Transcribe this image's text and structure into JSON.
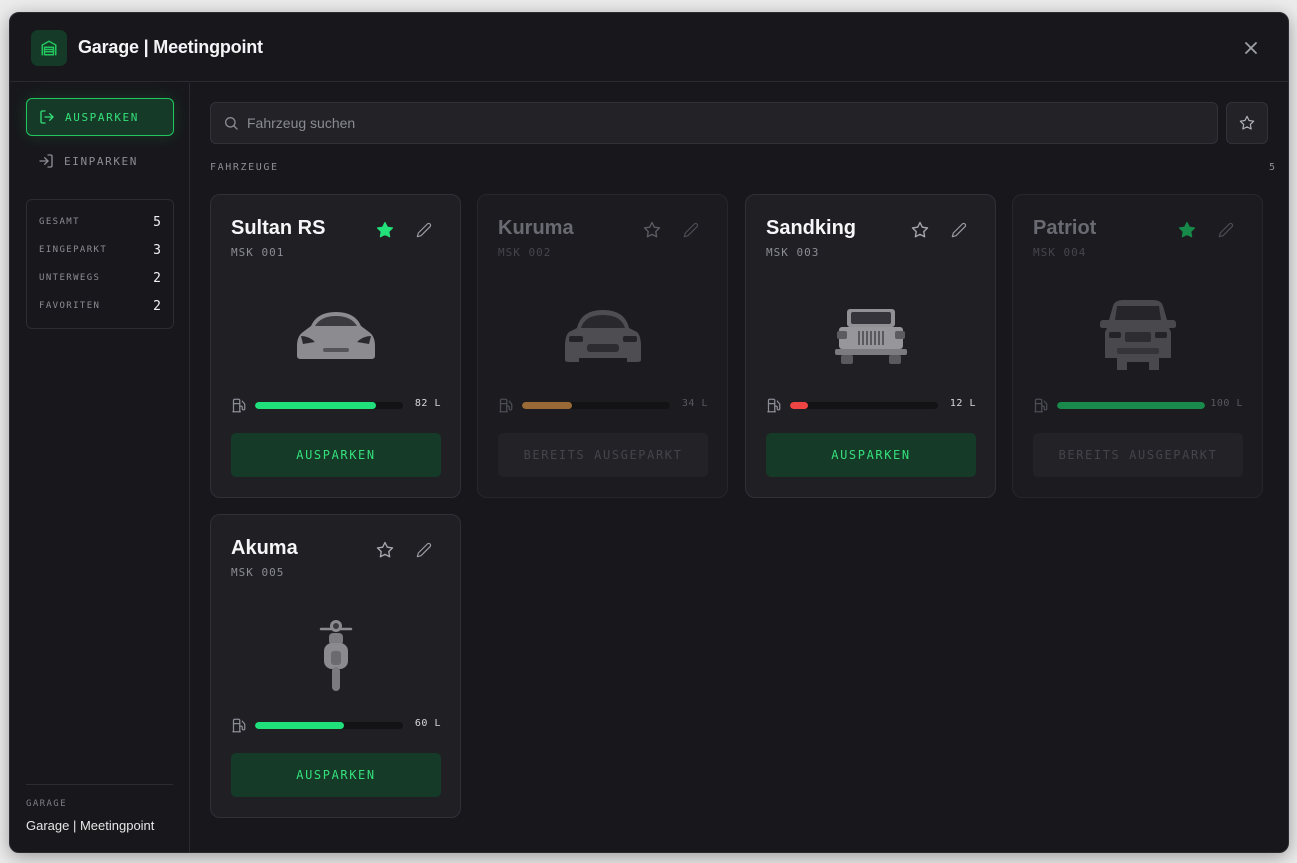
{
  "header": {
    "title": "Garage | Meetingpoint",
    "logo_icon": "garage-icon",
    "close_icon": "close-icon"
  },
  "sidebar": {
    "nav": [
      {
        "label": "AUSPARKEN",
        "icon": "exit-icon",
        "active": true
      },
      {
        "label": "EINPARKEN",
        "icon": "enter-icon",
        "active": false
      }
    ],
    "stats": [
      {
        "label": "GESAMT",
        "value": "5"
      },
      {
        "label": "EINGEPARKT",
        "value": "3"
      },
      {
        "label": "UNTERWEGS",
        "value": "2"
      },
      {
        "label": "FAVORITEN",
        "value": "2"
      }
    ],
    "footer": {
      "label": "GARAGE",
      "name": "Garage | Meetingpoint"
    }
  },
  "main": {
    "search_placeholder": "Fahrzeug suchen",
    "section_label": "FAHRZEUGE",
    "section_count": "5"
  },
  "colors": {
    "accent": "#22c55e",
    "accent_text": "#34e07a",
    "fuel_high": "#1fe07a",
    "fuel_mid": "#9a6a36",
    "fuel_low": "#ef4444",
    "fav_on": "#22e07a"
  },
  "vehicles": [
    {
      "name": "Sultan RS",
      "plate": "MSK 001",
      "fuel_percent": 82,
      "fuel_text": "82 L",
      "fuel_color": "#1fe07a",
      "favorite": true,
      "available": true,
      "button": "AUSPARKEN",
      "image_icon": "sports-car-icon"
    },
    {
      "name": "Kuruma",
      "plate": "MSK 002",
      "fuel_percent": 34,
      "fuel_text": "34 L",
      "fuel_color": "#9a6a36",
      "favorite": false,
      "available": false,
      "button": "BEREITS AUSGEPARKT",
      "image_icon": "sedan-icon"
    },
    {
      "name": "Sandking",
      "plate": "MSK 003",
      "fuel_percent": 12,
      "fuel_text": "12 L",
      "fuel_color": "#ef4444",
      "favorite": false,
      "available": true,
      "button": "AUSPARKEN",
      "image_icon": "offroad-truck-icon"
    },
    {
      "name": "Patriot",
      "plate": "MSK 004",
      "fuel_percent": 100,
      "fuel_text": "100 L",
      "fuel_color": "#1a8a4c",
      "favorite": true,
      "available": false,
      "button": "BEREITS AUSGEPARKT",
      "image_icon": "suv-icon"
    },
    {
      "name": "Akuma",
      "plate": "MSK 005",
      "fuel_percent": 60,
      "fuel_text": "60 L",
      "fuel_color": "#1fe07a",
      "favorite": false,
      "available": true,
      "button": "AUSPARKEN",
      "image_icon": "motorcycle-icon"
    }
  ]
}
